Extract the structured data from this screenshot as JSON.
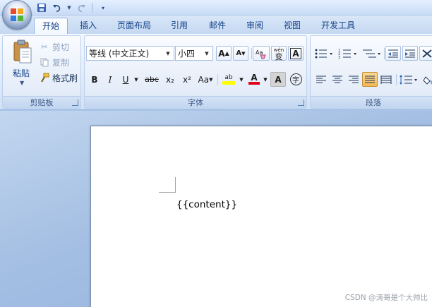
{
  "quick_access": {
    "save_icon": "save-icon",
    "undo_icon": "undo-icon",
    "redo_icon": "redo-icon",
    "customize_icon": "customize-qat-icon"
  },
  "tabs": [
    {
      "label": "开始",
      "active": true
    },
    {
      "label": "插入"
    },
    {
      "label": "页面布局"
    },
    {
      "label": "引用"
    },
    {
      "label": "邮件"
    },
    {
      "label": "审阅"
    },
    {
      "label": "视图"
    },
    {
      "label": "开发工具"
    }
  ],
  "clipboard": {
    "group_label": "剪贴板",
    "paste_label": "粘贴",
    "cut_label": "剪切",
    "copy_label": "复制",
    "format_painter_label": "格式刷"
  },
  "font": {
    "group_label": "字体",
    "font_name": "等线 (中文正文)",
    "font_size": "小四",
    "grow_label": "A",
    "shrink_label": "A",
    "phonetic_label": "wén",
    "phonetic_char": "变",
    "char_border_label": "A",
    "bold_label": "B",
    "italic_label": "I",
    "underline_label": "U",
    "strike_label": "abc",
    "subscript_label": "x₂",
    "superscript_label": "x²",
    "case_label": "Aa",
    "highlight_label": "ab",
    "font_color_label": "A",
    "char_shading_label": "A",
    "enclose_label": "字",
    "highlight_color": "#ffff00",
    "font_color": "#e3001b"
  },
  "paragraph": {
    "group_label": "段落"
  },
  "document": {
    "body_text": "{{content}}"
  },
  "watermark": "CSDN @涛哥是个大帅比"
}
